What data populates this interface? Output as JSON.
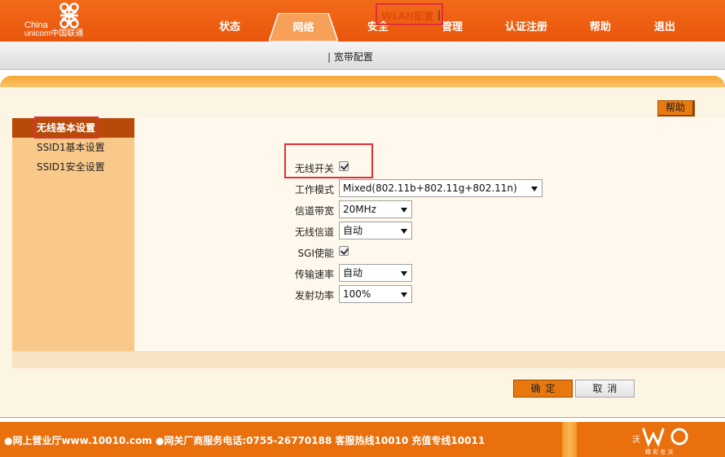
{
  "brand": {
    "line1": "China",
    "line2": "unicom中国联通",
    "slogan": "精 彩 在 沃"
  },
  "nav": {
    "items": [
      "状态",
      "网络",
      "安全",
      "管理",
      "认证注册",
      "帮助",
      "退出"
    ],
    "active": "网络"
  },
  "subnav": {
    "items": [
      "宽带配置",
      "WLAN配置"
    ],
    "active": "WLAN配置",
    "separator": "|"
  },
  "help_button": "帮助",
  "sidebar": {
    "items": [
      "无线基本设置",
      "SSID1基本设置",
      "SSID1安全设置"
    ],
    "active": "无线基本设置"
  },
  "form": {
    "wireless_switch": {
      "label": "无线开关",
      "checked": true
    },
    "work_mode": {
      "label": "工作模式",
      "value": "Mixed(802.11b+802.11g+802.11n)"
    },
    "channel_width": {
      "label": "信道带宽",
      "value": "20MHz"
    },
    "wireless_channel": {
      "label": "无线信道",
      "value": "自动"
    },
    "sgi": {
      "label": "SGI使能",
      "checked": true
    },
    "tx_rate": {
      "label": "传输速率",
      "value": "自动"
    },
    "tx_power": {
      "label": "发射功率",
      "value": "100%"
    }
  },
  "buttons": {
    "ok": "确定",
    "cancel": "取消"
  },
  "footer": {
    "text": "●网上营业厅www.10010.com ●网关厂商服务电话:0755-26770188 客服热线10010 充值专线10011"
  },
  "colors": {
    "header": "#e8560b",
    "panel": "#f39a26",
    "sidebar": "#f9c98a",
    "sidebar_active": "#b84a09",
    "highlight_border": "#e0303a",
    "footer": "#e9700c"
  }
}
